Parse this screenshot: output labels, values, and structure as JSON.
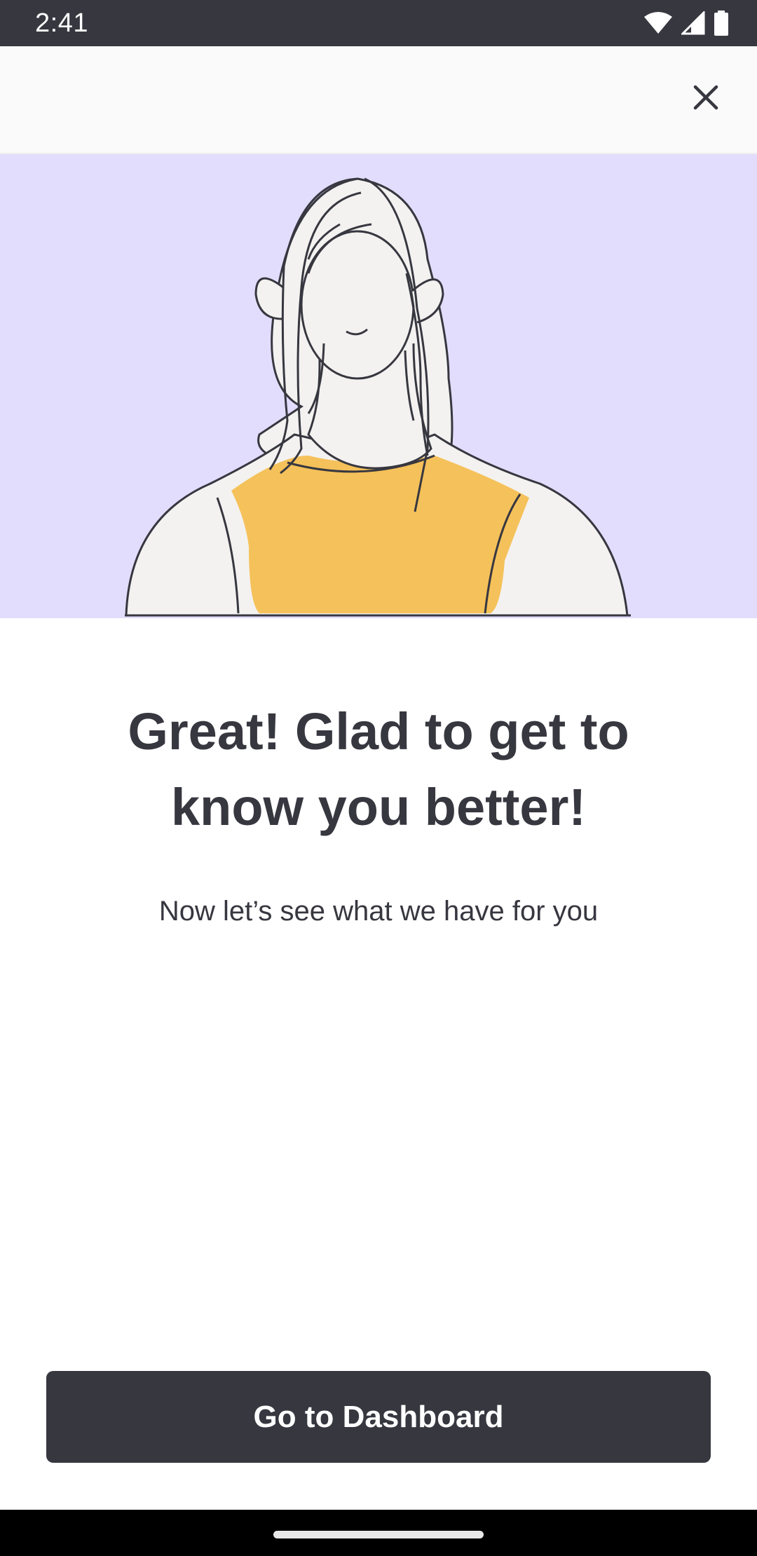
{
  "status_bar": {
    "time": "2:41",
    "icons": [
      "wifi-icon",
      "cellular-signal-icon",
      "battery-icon"
    ]
  },
  "top_bar": {
    "close_icon": "close-icon"
  },
  "hero": {
    "illustration": "woman-portrait-illustration",
    "colors": {
      "background": "#e2ddfd",
      "shirt": "#f5c15a",
      "skin": "#f3f2f0",
      "outline": "#373740"
    }
  },
  "content": {
    "headline": "Great! Glad to get to know you better!",
    "subtitle": "Now let’s see what we have for you"
  },
  "actions": {
    "primary_label": "Go to Dashboard"
  },
  "theme": {
    "dark": "#373740",
    "status_bar": "#373740",
    "top_bar": "#fafafa"
  }
}
